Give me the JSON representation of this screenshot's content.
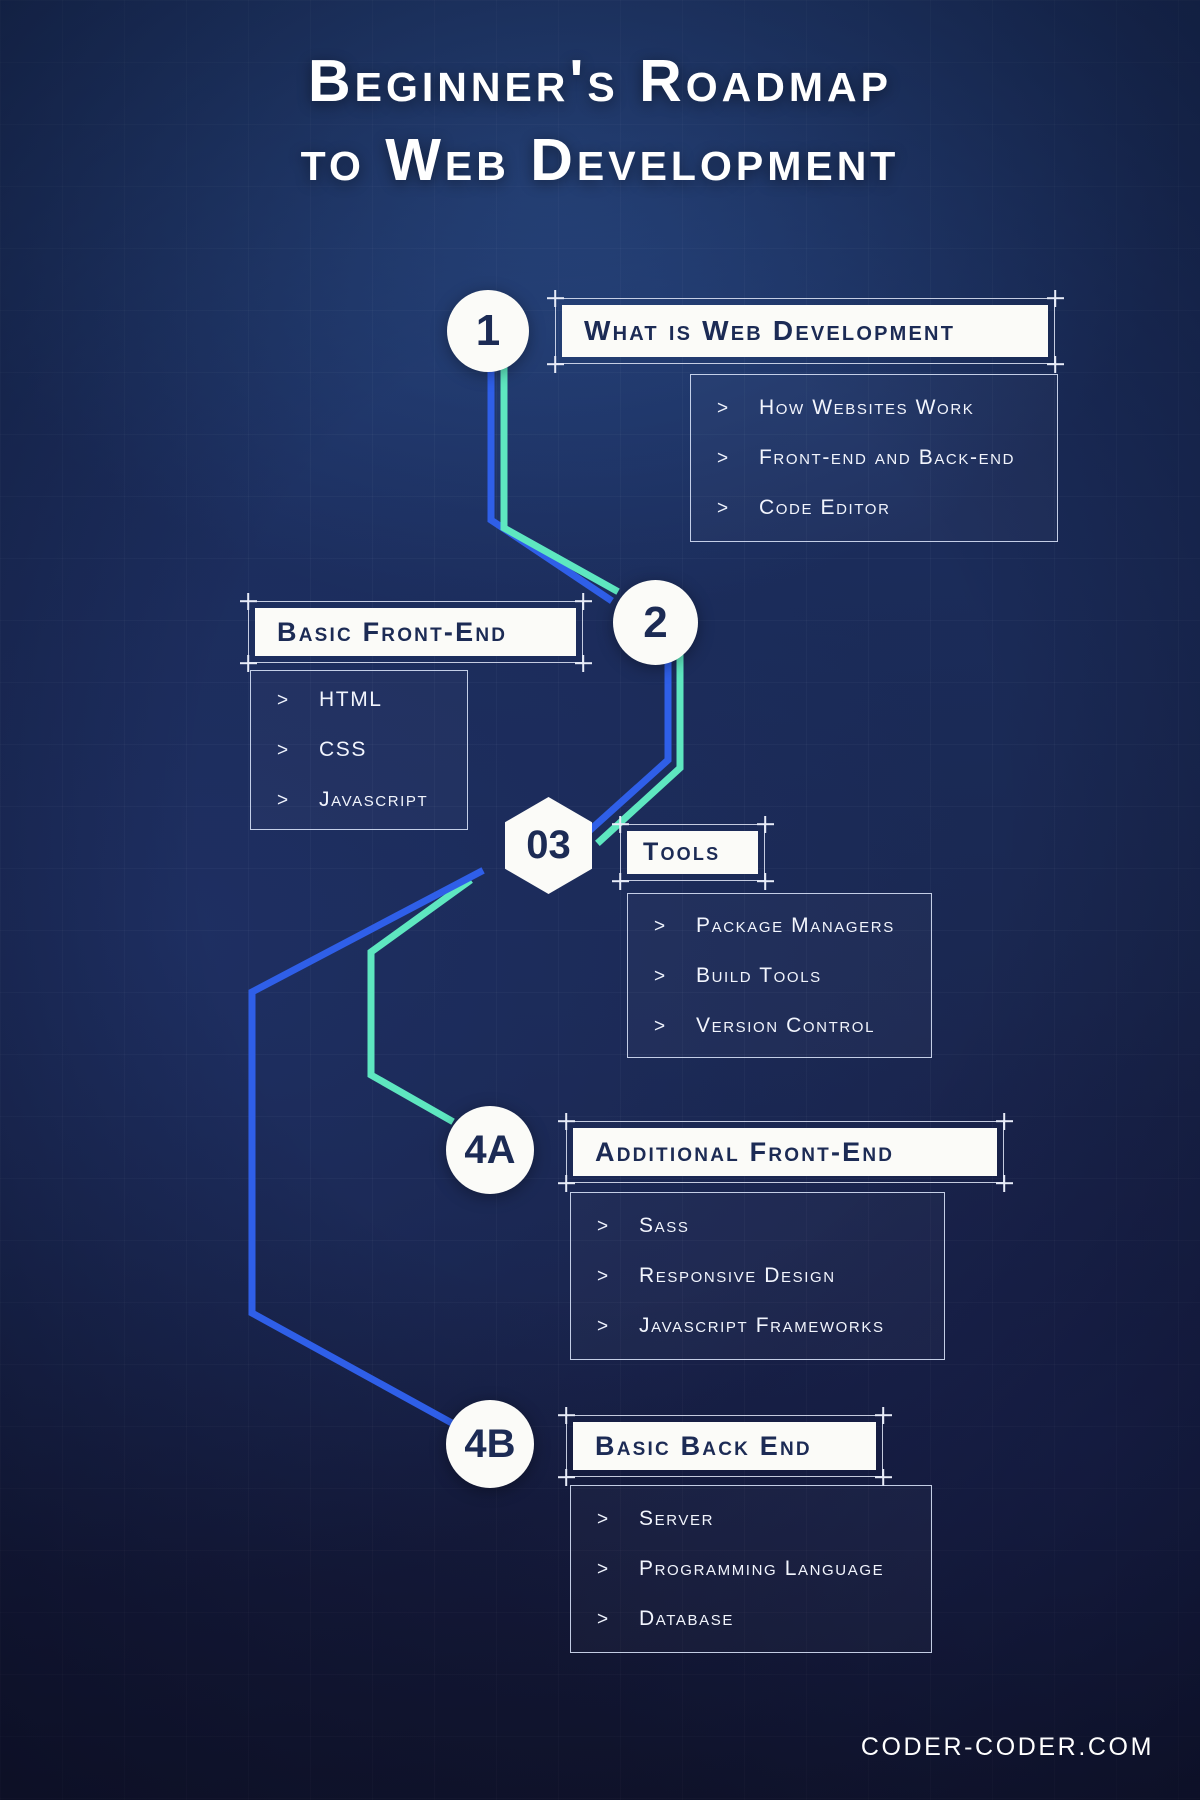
{
  "title": {
    "line1": "Beginner's Roadmap",
    "line2": "to Web Development"
  },
  "colors": {
    "background_dark": "#141833",
    "background_light": "#1d3567",
    "node_fill": "#fbfbf8",
    "node_text": "#1c2b55",
    "connector_blue": "#2f5fe8",
    "connector_teal": "#5ee7c0",
    "body_text": "#f2f5fd"
  },
  "steps": [
    {
      "marker": "1",
      "marker_shape": "circle",
      "heading": "What is Web Development",
      "bullet_marker": ">",
      "items": [
        "How Websites Work",
        "Front-end and Back-end",
        "Code Editor"
      ]
    },
    {
      "marker": "2",
      "marker_shape": "circle",
      "heading": "Basic Front-End",
      "bullet_marker": ">",
      "items": [
        "HTML",
        "CSS",
        "Javascript"
      ]
    },
    {
      "marker": "03",
      "marker_shape": "hexagon",
      "heading": "Tools",
      "bullet_marker": ">",
      "items": [
        "Package Managers",
        "Build Tools",
        "Version Control"
      ]
    },
    {
      "marker": "4A",
      "marker_shape": "circle",
      "heading": "Additional Front-End",
      "bullet_marker": ">",
      "items": [
        "Sass",
        "Responsive Design",
        "Javascript Frameworks"
      ]
    },
    {
      "marker": "4B",
      "marker_shape": "circle",
      "heading": "Basic Back End",
      "bullet_marker": ">",
      "items": [
        "Server",
        "Programming Language",
        "Database"
      ]
    }
  ],
  "footer": {
    "attribution": "CODER-CODER.COM"
  }
}
